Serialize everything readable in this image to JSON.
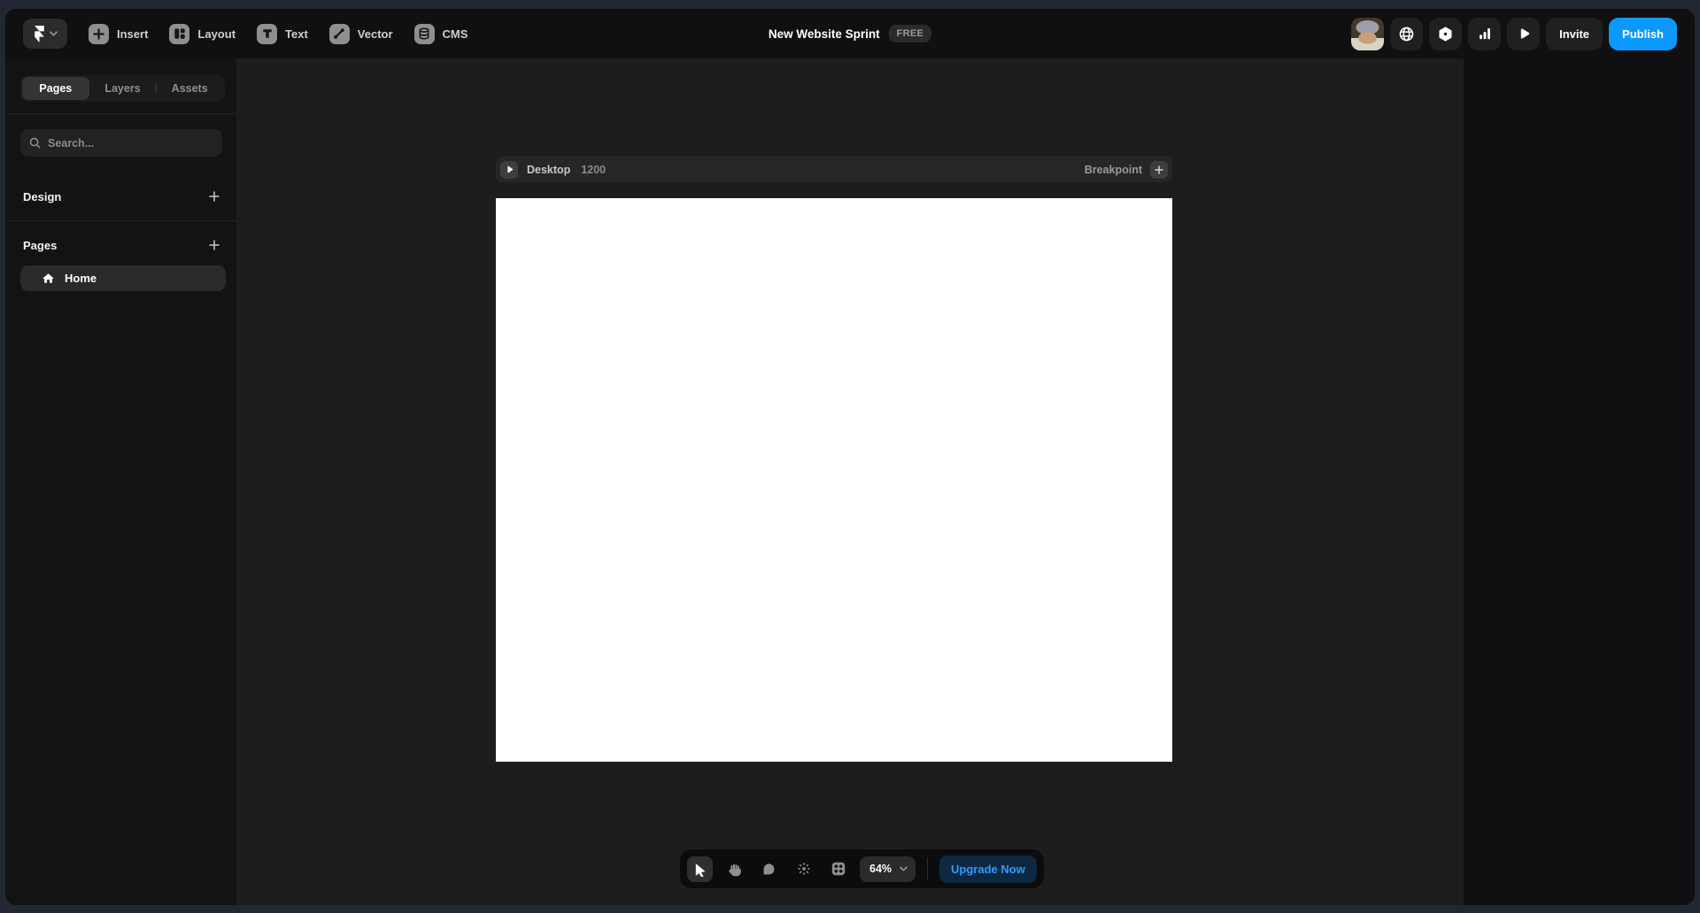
{
  "topbar": {
    "menu": [
      {
        "label": "Insert",
        "icon": "plus-icon"
      },
      {
        "label": "Layout",
        "icon": "layout-icon"
      },
      {
        "label": "Text",
        "icon": "text-icon"
      },
      {
        "label": "Vector",
        "icon": "vector-icon"
      },
      {
        "label": "CMS",
        "icon": "cms-icon"
      }
    ],
    "project_title": "New Website Sprint",
    "plan_badge": "FREE",
    "invite_label": "Invite",
    "publish_label": "Publish",
    "right_icons": [
      "avatar",
      "globe-icon",
      "plugins-icon",
      "analytics-icon",
      "preview-play-icon"
    ]
  },
  "sidebar": {
    "tabs": [
      {
        "label": "Pages",
        "active": true
      },
      {
        "label": "Layers",
        "active": false
      },
      {
        "label": "Assets",
        "active": false
      }
    ],
    "search_placeholder": "Search...",
    "sections": [
      {
        "label": "Design"
      },
      {
        "label": "Pages"
      }
    ],
    "pages": [
      {
        "label": "Home",
        "icon": "home-icon",
        "active": true
      }
    ]
  },
  "canvas": {
    "breakpoint_name": "Desktop",
    "breakpoint_width": "1200",
    "breakpoint_action_label": "Breakpoint"
  },
  "bottom_toolbar": {
    "tools": [
      "select-tool",
      "hand-tool",
      "comment-tool",
      "effects-tool",
      "insert-grid-tool"
    ],
    "zoom_level": "64%",
    "upgrade_label": "Upgrade Now"
  },
  "colors": {
    "accent_blue": "#0b99ff",
    "upgrade_text_blue": "#2f9bff",
    "topbar_bg": "#101010",
    "sidebar_bg": "#131313",
    "canvas_bg": "#1d1d1f",
    "right_panel_bg": "#101012",
    "frame_bg": "#ffffff",
    "desktop_edge": "#222734"
  }
}
